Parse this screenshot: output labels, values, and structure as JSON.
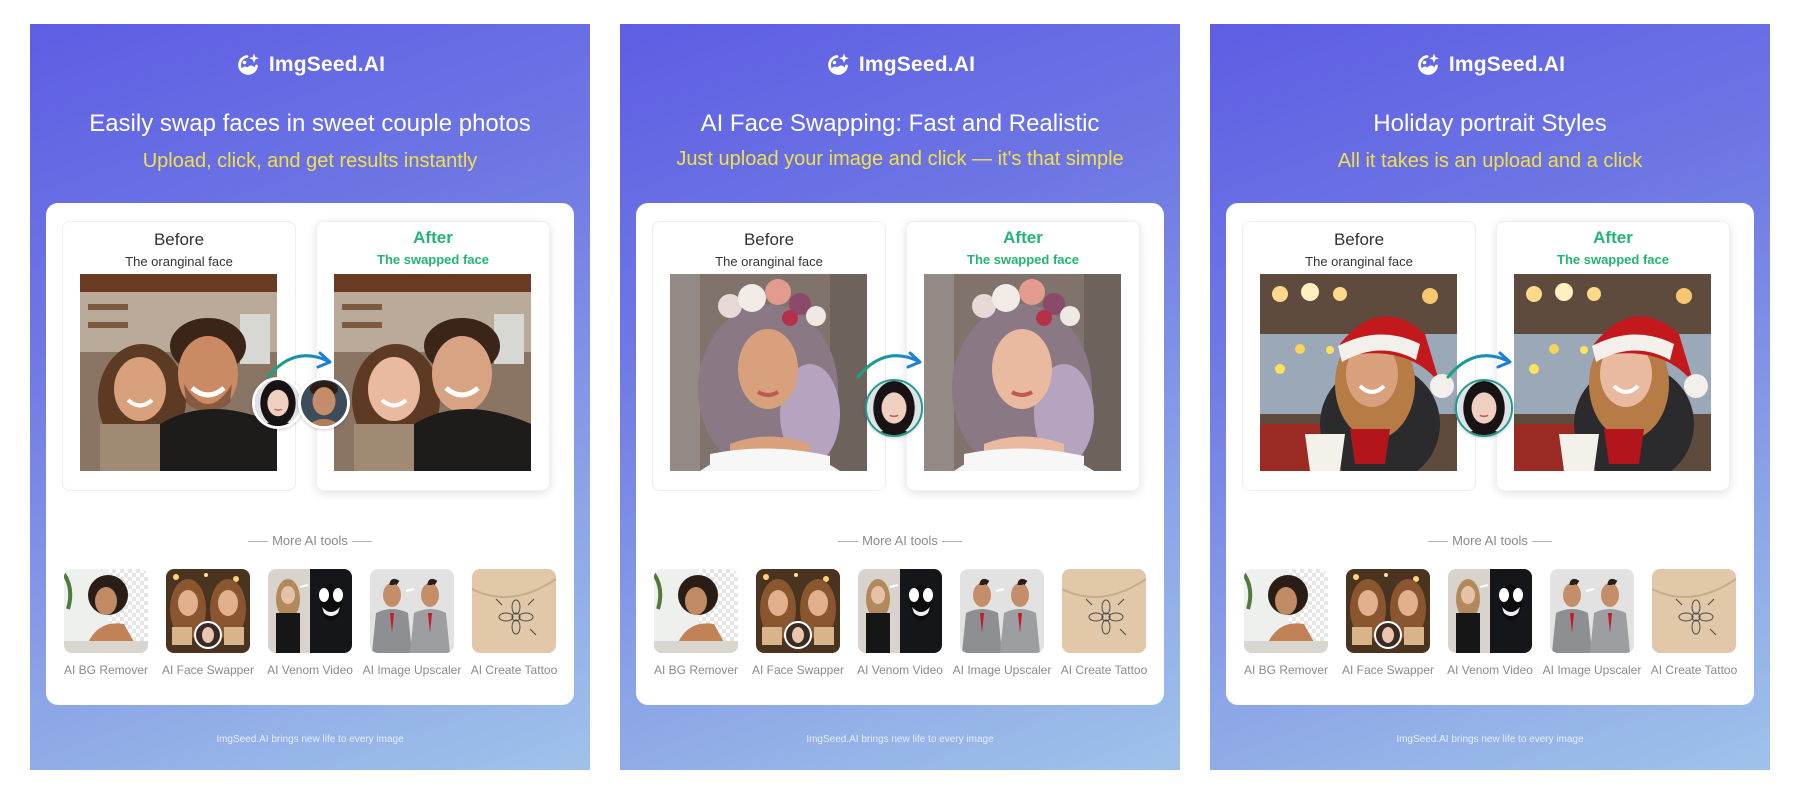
{
  "panels": [
    {
      "brand": "ImgSeed.AI",
      "headline": "Easily swap faces in sweet couple photos",
      "tagline": "Upload, click, and get results instantly",
      "before_title": "Before",
      "before_sub": "The oranginal face",
      "after_title": "After",
      "after_sub": "The swapped face",
      "scene": "couple",
      "source_faces": [
        "woman-face",
        "man-face"
      ],
      "more_tools_label": "More AI tools",
      "tools": [
        {
          "label": "AI BG Remover",
          "icon": "bg-remover-thumb"
        },
        {
          "label": "AI Face Swapper",
          "icon": "face-swapper-thumb"
        },
        {
          "label": "AI Venom Video",
          "icon": "venom-video-thumb"
        },
        {
          "label": "AI Image Upscaler",
          "icon": "image-upscaler-thumb"
        },
        {
          "label": "AI Create Tattoo",
          "icon": "create-tattoo-thumb"
        }
      ],
      "footer": "ImgSeed.AI brings new life to every image"
    },
    {
      "brand": "ImgSeed.AI",
      "headline": "AI Face Swapping: Fast and Realistic",
      "tagline": "Just upload your image and click — it's that simple",
      "before_title": "Before",
      "before_sub": "The oranginal face",
      "after_title": "After",
      "after_sub": "The swapped face",
      "scene": "flower-crown",
      "source_faces": [
        "woman-face"
      ],
      "more_tools_label": "More AI tools",
      "tools": [
        {
          "label": "AI BG Remover",
          "icon": "bg-remover-thumb"
        },
        {
          "label": "AI Face Swapper",
          "icon": "face-swapper-thumb"
        },
        {
          "label": "AI Venom Video",
          "icon": "venom-video-thumb"
        },
        {
          "label": "AI Image Upscaler",
          "icon": "image-upscaler-thumb"
        },
        {
          "label": "AI Create Tattoo",
          "icon": "create-tattoo-thumb"
        }
      ],
      "footer": "ImgSeed.AI brings new life to every image"
    },
    {
      "brand": "ImgSeed.AI",
      "headline": "Holiday portrait Styles",
      "tagline": "All it takes is an upload and a click",
      "before_title": "Before",
      "before_sub": "The oranginal face",
      "after_title": "After",
      "after_sub": "The swapped face",
      "scene": "santa-hat",
      "source_faces": [
        "woman-face"
      ],
      "more_tools_label": "More AI tools",
      "tools": [
        {
          "label": "AI BG Remover",
          "icon": "bg-remover-thumb"
        },
        {
          "label": "AI Face Swapper",
          "icon": "face-swapper-thumb"
        },
        {
          "label": "AI Venom Video",
          "icon": "venom-video-thumb"
        },
        {
          "label": "AI Image Upscaler",
          "icon": "image-upscaler-thumb"
        },
        {
          "label": "AI Create Tattoo",
          "icon": "create-tattoo-thumb"
        }
      ],
      "footer": "ImgSeed.AI brings new life to every image"
    }
  ],
  "colors": {
    "gradient_start": "#5d5ee3",
    "gradient_end": "#9fc2ea",
    "tagline_yellow": "#f2e04a",
    "after_green": "#22b573",
    "arrow_teal": "#1aa37a",
    "arrow_blue": "#1d7fd6"
  }
}
